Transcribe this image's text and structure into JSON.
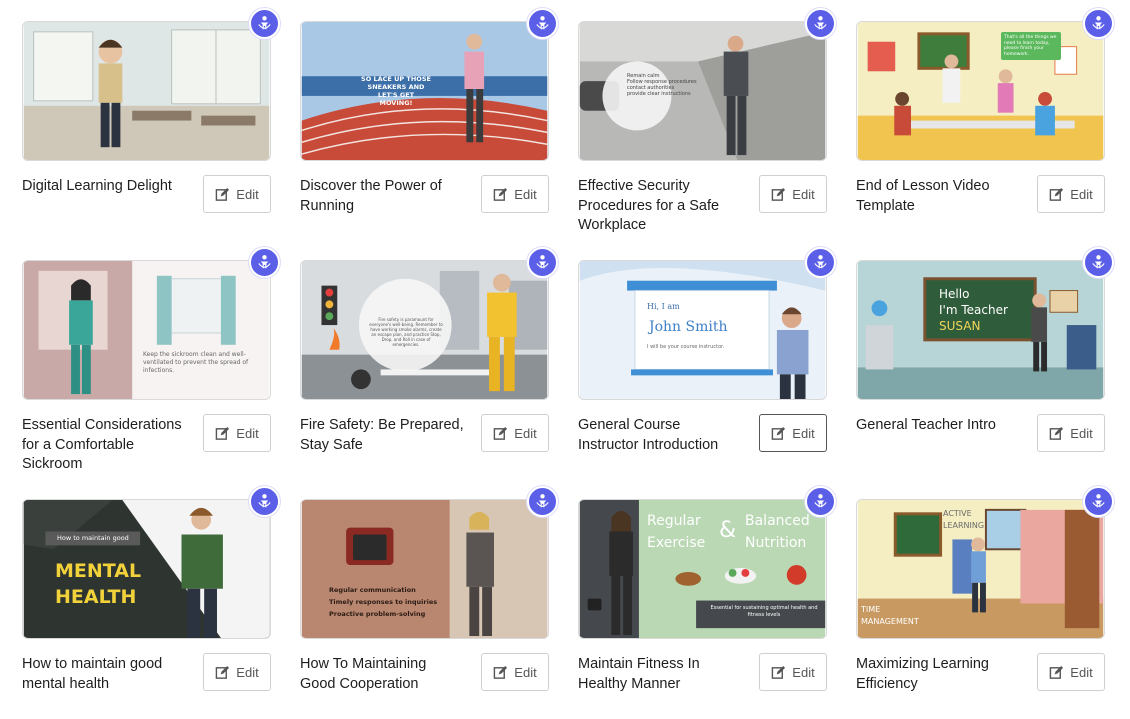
{
  "edit_label": "Edit",
  "colors": {
    "badge": "#5b5fe8",
    "border": "#cfcfcf"
  },
  "cards": [
    {
      "title": "Digital Learning Delight",
      "overlay": []
    },
    {
      "title": "Discover the Power of Running",
      "overlay": [
        "SO LACE UP THOSE SNEAKERS AND LET'S GET MOVING!"
      ]
    },
    {
      "title": "Effective Security Procedures for a Safe Workplace",
      "overlay": [
        "Remain calm",
        "Follow response procedures",
        "contact authorities",
        "provide clear instructions"
      ]
    },
    {
      "title": "End of Lesson Video Template",
      "overlay": [
        "That's all the things we need to learn today, please finish your homework."
      ]
    },
    {
      "title": "Essential Considerations for a Comfortable Sickroom",
      "overlay": [
        "Keep the sickroom clean and well-ventilated to prevent the spread of infections."
      ]
    },
    {
      "title": "Fire Safety: Be Prepared, Stay Safe",
      "overlay": [
        "Fire safety is paramount for everyone's well-being. Remember to have working smoke alarms, create an escape plan, and practice Stop, Drop, and Roll in case of emergencies."
      ]
    },
    {
      "title": "General Course Instructor Introduction",
      "overlay": [
        "Hi, I am",
        "John Smith",
        "I will be your course instructor."
      ]
    },
    {
      "title": "General Teacher Intro",
      "overlay": [
        "Hello",
        "I'm Teacher",
        "SUSAN"
      ]
    },
    {
      "title": "How to maintain good mental health",
      "overlay": [
        "How to maintain good",
        "MENTAL",
        "HEALTH"
      ]
    },
    {
      "title": "How To Maintaining Good Cooperation",
      "overlay": [
        "Regular communication",
        "Timely responses to inquiries",
        "Proactive problem-solving"
      ]
    },
    {
      "title": "Maintain Fitness In Healthy Manner",
      "overlay": [
        "Regular",
        "Exercise",
        "&",
        "Balanced",
        "Nutrition",
        "Essential for sustaining optimal health and fitness levels"
      ]
    },
    {
      "title": "Maximizing Learning Efficiency",
      "overlay": [
        "ACTIVE",
        "LEARNING",
        "TIME",
        "MANAGEMENT"
      ]
    }
  ]
}
